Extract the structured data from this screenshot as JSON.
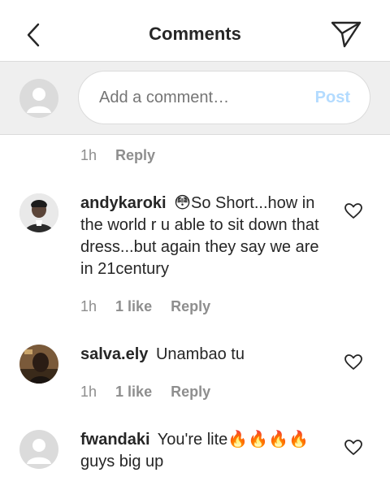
{
  "header": {
    "title": "Comments",
    "back_icon": "chevron-left-icon",
    "send_icon": "paper-plane-icon"
  },
  "composer": {
    "placeholder": "Add a comment…",
    "post_label": "Post",
    "post_color": "#b3dbff"
  },
  "prev_comment": {
    "time": "1h",
    "reply": "Reply"
  },
  "comments": [
    {
      "user": "andykaroki",
      "text": "😳So Short...how in the world r u able to sit down that dress...but again they say we are in 21century",
      "time": "1h",
      "likes": "1 like",
      "reply": "Reply"
    },
    {
      "user": "salva.ely",
      "text": "Unambao tu",
      "time": "1h",
      "likes": "1 like",
      "reply": "Reply"
    },
    {
      "user": "fwandaki",
      "text": "You're lite🔥🔥🔥🔥 guys big up",
      "time": "",
      "likes": "",
      "reply": ""
    }
  ]
}
